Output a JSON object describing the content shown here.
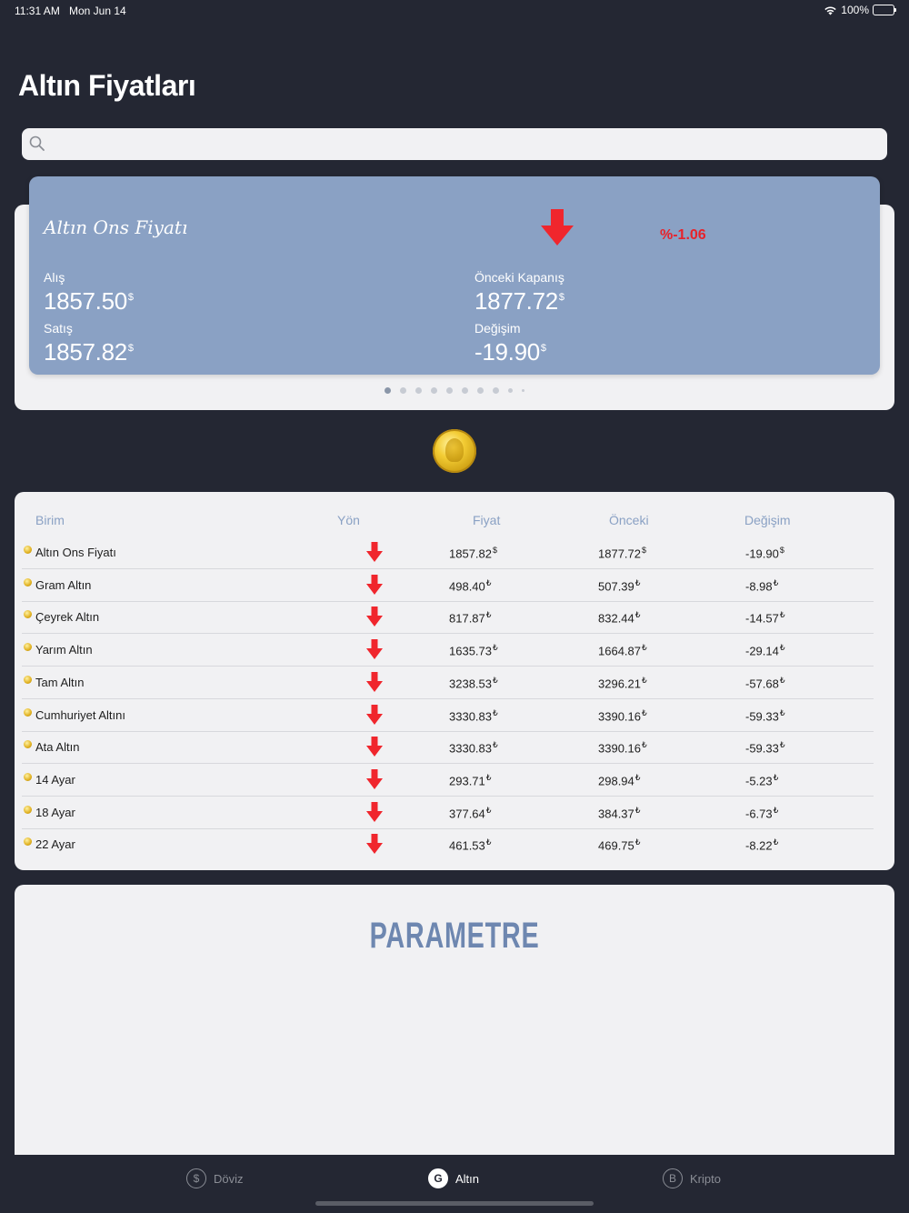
{
  "status_bar": {
    "time": "11:31 AM",
    "date": "Mon Jun 14",
    "battery": "100%"
  },
  "page": {
    "title": "Altın Fiyatları"
  },
  "search": {
    "placeholder": "",
    "value": ""
  },
  "featured_card": {
    "title": "Altın Ons Fiyatı",
    "direction_icon": "arrow-down-icon",
    "percent": "%-1.06",
    "buy_label": "Alış",
    "buy_value": "1857.50",
    "sell_label": "Satış",
    "sell_value": "1857.82",
    "prev_close_label": "Önceki Kapanış",
    "prev_close_value": "1877.72",
    "change_label": "Değişim",
    "change_value": "-19.90",
    "currency_symbol": "$"
  },
  "carousel": {
    "page_count": 10,
    "active_index": 0
  },
  "table": {
    "headers": {
      "unit": "Birim",
      "direction": "Yön",
      "price": "Fiyat",
      "previous": "Önceki",
      "change": "Değişim"
    },
    "rows": [
      {
        "name": "Altın Ons Fiyatı",
        "price": "1857.82",
        "previous": "1877.72",
        "change": "-19.90",
        "currency": "$",
        "direction": "down"
      },
      {
        "name": "Gram Altın",
        "price": "498.40",
        "previous": "507.39",
        "change": "-8.98",
        "currency": "₺",
        "direction": "down"
      },
      {
        "name": "Çeyrek Altın",
        "price": "817.87",
        "previous": "832.44",
        "change": "-14.57",
        "currency": "₺",
        "direction": "down"
      },
      {
        "name": "Yarım Altın",
        "price": "1635.73",
        "previous": "1664.87",
        "change": "-29.14",
        "currency": "₺",
        "direction": "down"
      },
      {
        "name": "Tam Altın",
        "price": "3238.53",
        "previous": "3296.21",
        "change": "-57.68",
        "currency": "₺",
        "direction": "down"
      },
      {
        "name": "Cumhuriyet Altını",
        "price": "3330.83",
        "previous": "3390.16",
        "change": "-59.33",
        "currency": "₺",
        "direction": "down"
      },
      {
        "name": "Ata Altın",
        "price": "3330.83",
        "previous": "3390.16",
        "change": "-59.33",
        "currency": "₺",
        "direction": "down"
      },
      {
        "name": "14 Ayar",
        "price": "293.71",
        "previous": "298.94",
        "change": "-5.23",
        "currency": "₺",
        "direction": "down"
      },
      {
        "name": "18 Ayar",
        "price": "377.64",
        "previous": "384.37",
        "change": "-6.73",
        "currency": "₺",
        "direction": "down"
      },
      {
        "name": "22 Ayar",
        "price": "461.53",
        "previous": "469.75",
        "change": "-8.22",
        "currency": "₺",
        "direction": "down"
      }
    ]
  },
  "sponsor": {
    "logo_text": "PARAMETRE"
  },
  "tabs": [
    {
      "label": "Döviz",
      "icon_glyph": "$",
      "icon": "dollar-circle-icon",
      "active": false
    },
    {
      "label": "Altın",
      "icon_glyph": "G",
      "icon": "gold-circle-icon",
      "active": true
    },
    {
      "label": "Kripto",
      "icon_glyph": "B",
      "icon": "bitcoin-circle-icon",
      "active": false
    }
  ],
  "colors": {
    "background": "#242733",
    "card": "#8aa1c4",
    "panel": "#f1f1f3",
    "down": "#e8222a",
    "accent": "#6e87b0"
  }
}
